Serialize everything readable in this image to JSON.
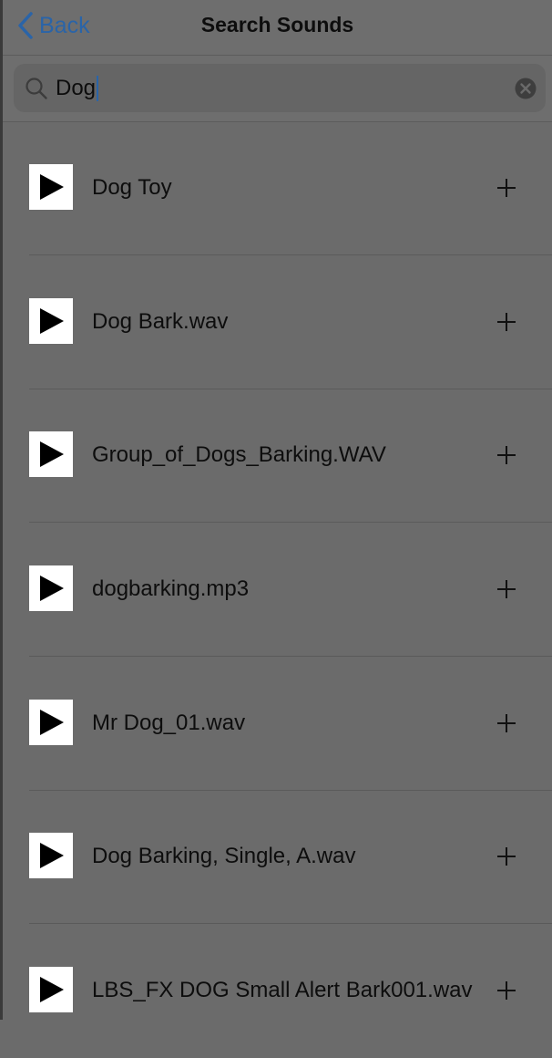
{
  "nav": {
    "back_label": "Back",
    "title": "Search Sounds"
  },
  "search": {
    "value": "Dog"
  },
  "results": [
    {
      "label": "Dog Toy"
    },
    {
      "label": "Dog Bark.wav"
    },
    {
      "label": "Group_of_Dogs_Barking.WAV"
    },
    {
      "label": "dogbarking.mp3"
    },
    {
      "label": "Mr Dog_01.wav"
    },
    {
      "label": "Dog Barking, Single, A.wav"
    },
    {
      "label": "LBS_FX DOG Small Alert Bark001.wav"
    }
  ],
  "colors": {
    "accent": "#2a64a8",
    "background": "#6b6b6b"
  },
  "icons": {
    "back": "chevron-left-icon",
    "search": "magnifier-icon",
    "clear": "clear-x-circle-icon",
    "play": "play-triangle-icon",
    "add": "plus-icon"
  }
}
